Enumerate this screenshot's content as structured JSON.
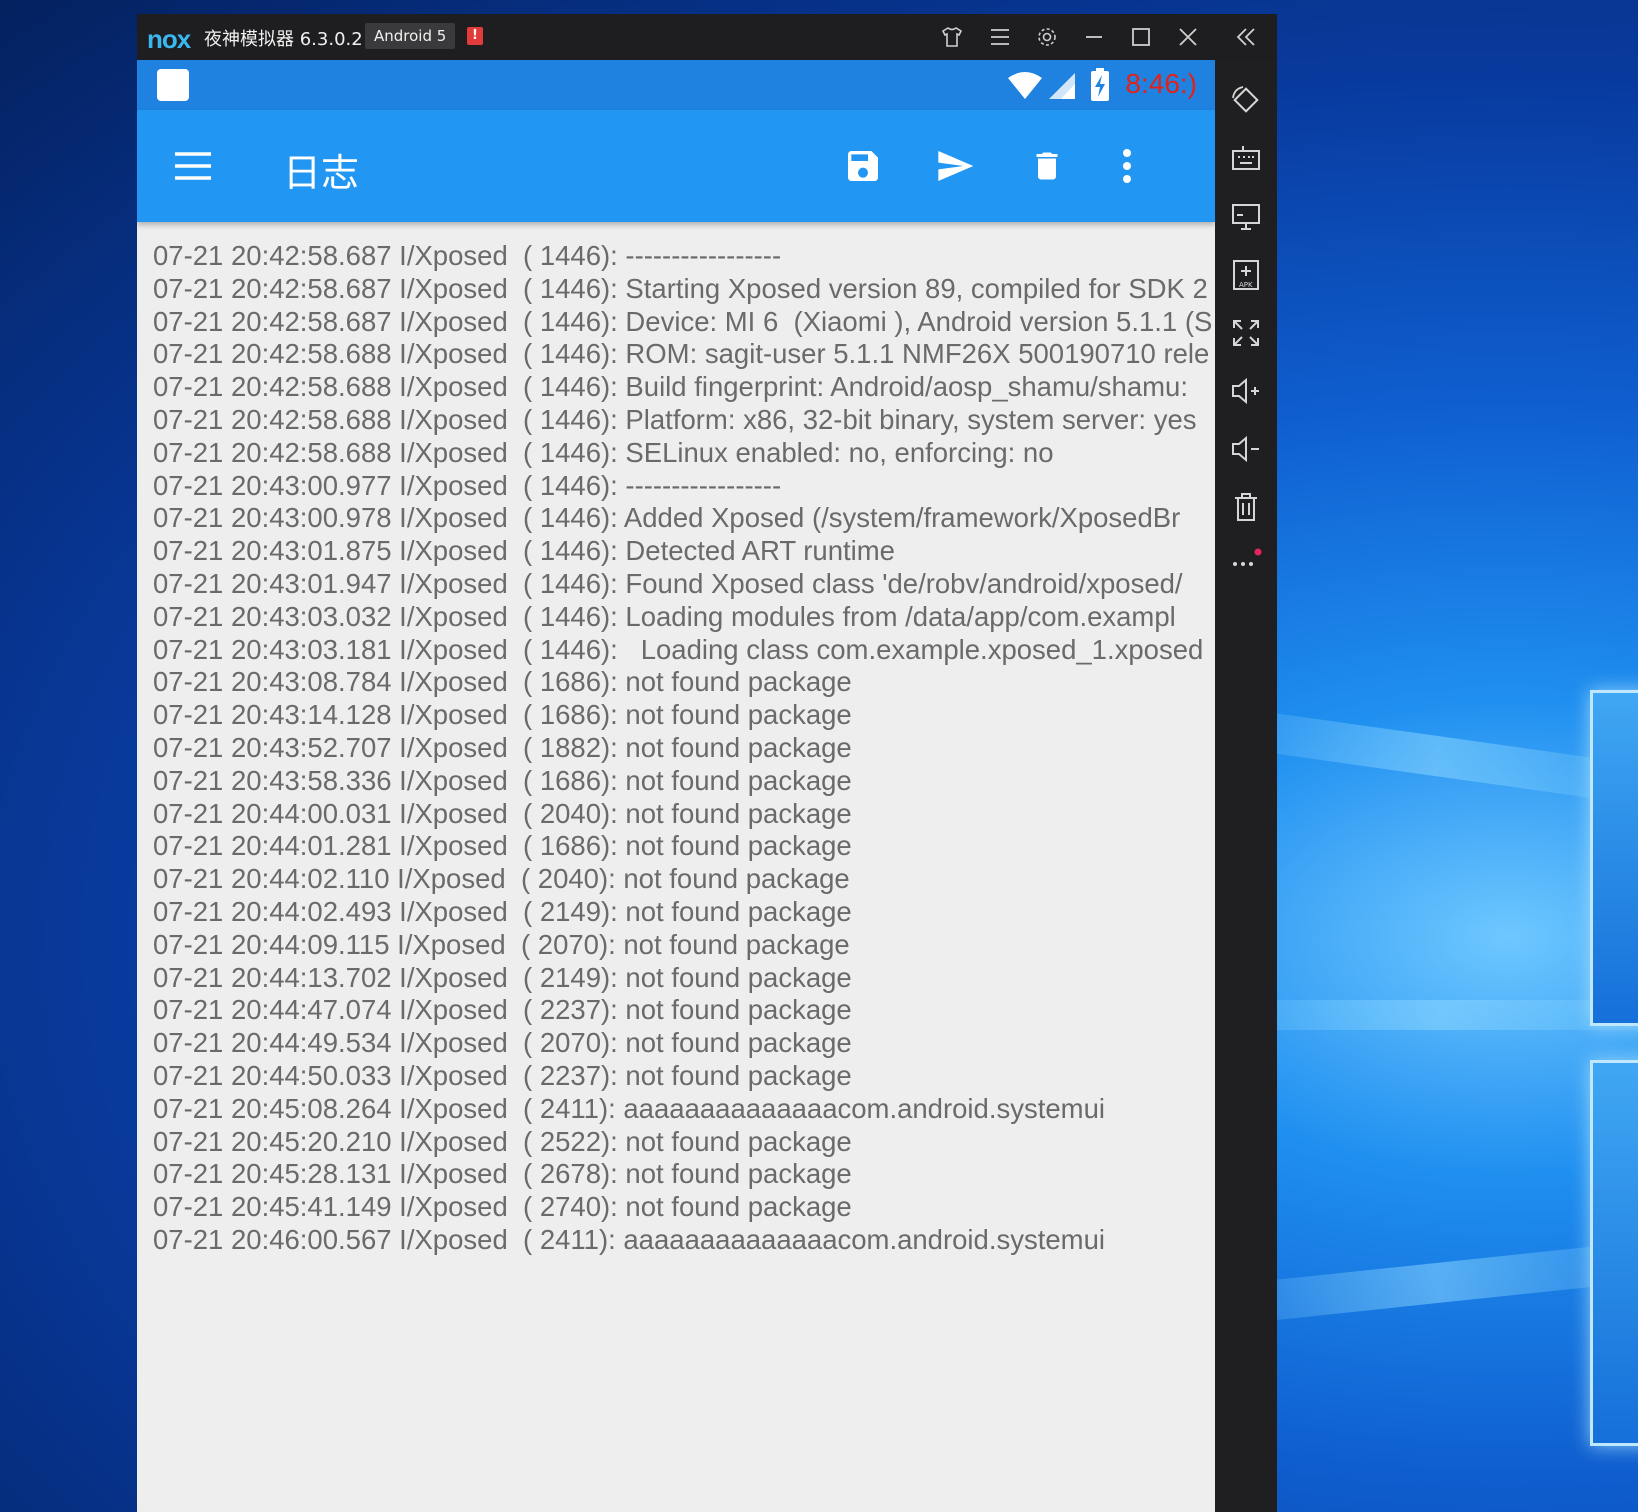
{
  "window": {
    "logo_text": "nox",
    "title": "夜神模拟器 6.3.0.2",
    "android_badge": "Android 5",
    "alert_badge": "!"
  },
  "status_bar": {
    "time": "8:46:)"
  },
  "app_bar": {
    "title": "日志"
  },
  "log_lines": [
    "07-21 20:42:58.687 I/Xposed  ( 1446): -----------------",
    "07-21 20:42:58.687 I/Xposed  ( 1446): Starting Xposed version 89, compiled for SDK 2",
    "07-21 20:42:58.687 I/Xposed  ( 1446): Device: MI 6  (Xiaomi ), Android version 5.1.1 (S",
    "07-21 20:42:58.688 I/Xposed  ( 1446): ROM: sagit-user 5.1.1 NMF26X 500190710 rele",
    "07-21 20:42:58.688 I/Xposed  ( 1446): Build fingerprint: Android/aosp_shamu/shamu:",
    "07-21 20:42:58.688 I/Xposed  ( 1446): Platform: x86, 32-bit binary, system server: yes",
    "07-21 20:42:58.688 I/Xposed  ( 1446): SELinux enabled: no, enforcing: no",
    "07-21 20:43:00.977 I/Xposed  ( 1446): -----------------",
    "07-21 20:43:00.978 I/Xposed  ( 1446): Added Xposed (/system/framework/XposedBr",
    "07-21 20:43:01.875 I/Xposed  ( 1446): Detected ART runtime",
    "07-21 20:43:01.947 I/Xposed  ( 1446): Found Xposed class 'de/robv/android/xposed/",
    "07-21 20:43:03.032 I/Xposed  ( 1446): Loading modules from /data/app/com.exampl",
    "07-21 20:43:03.181 I/Xposed  ( 1446):   Loading class com.example.xposed_1.xposed",
    "07-21 20:43:08.784 I/Xposed  ( 1686): not found package",
    "07-21 20:43:14.128 I/Xposed  ( 1686): not found package",
    "07-21 20:43:52.707 I/Xposed  ( 1882): not found package",
    "07-21 20:43:58.336 I/Xposed  ( 1686): not found package",
    "07-21 20:44:00.031 I/Xposed  ( 2040): not found package",
    "07-21 20:44:01.281 I/Xposed  ( 1686): not found package",
    "07-21 20:44:02.110 I/Xposed  ( 2040): not found package",
    "07-21 20:44:02.493 I/Xposed  ( 2149): not found package",
    "07-21 20:44:09.115 I/Xposed  ( 2070): not found package",
    "07-21 20:44:13.702 I/Xposed  ( 2149): not found package",
    "07-21 20:44:47.074 I/Xposed  ( 2237): not found package",
    "07-21 20:44:49.534 I/Xposed  ( 2070): not found package",
    "07-21 20:44:50.033 I/Xposed  ( 2237): not found package",
    "07-21 20:45:08.264 I/Xposed  ( 2411): aaaaaaaaaaaaaacom.android.systemui",
    "07-21 20:45:20.210 I/Xposed  ( 2522): not found package",
    "07-21 20:45:28.131 I/Xposed  ( 2678): not found package",
    "07-21 20:45:41.149 I/Xposed  ( 2740): not found package",
    "07-21 20:46:00.567 I/Xposed  ( 2411): aaaaaaaaaaaaaacom.android.systemui"
  ],
  "colors": {
    "status_bar": "#1f82e0",
    "app_bar": "#2196f3",
    "log_text": "#6a6a6a",
    "log_background": "#eeeeee",
    "clock": "#e0221b",
    "emulator_frame": "#1e1e20"
  },
  "icons": {
    "titlebar": [
      "shirt-icon",
      "menu-icon",
      "settings-icon",
      "minimize-icon",
      "maximize-icon",
      "close-icon"
    ],
    "app_bar": [
      "hamburger-menu-icon",
      "save-icon",
      "send-icon",
      "delete-icon",
      "more-vert-icon"
    ],
    "sidebar": [
      "rotate-icon",
      "keyboard-icon",
      "screen-icon",
      "add-apk-icon",
      "fullscreen-icon",
      "volume-up-icon",
      "volume-down-icon",
      "trash-icon",
      "more-icon"
    ]
  }
}
